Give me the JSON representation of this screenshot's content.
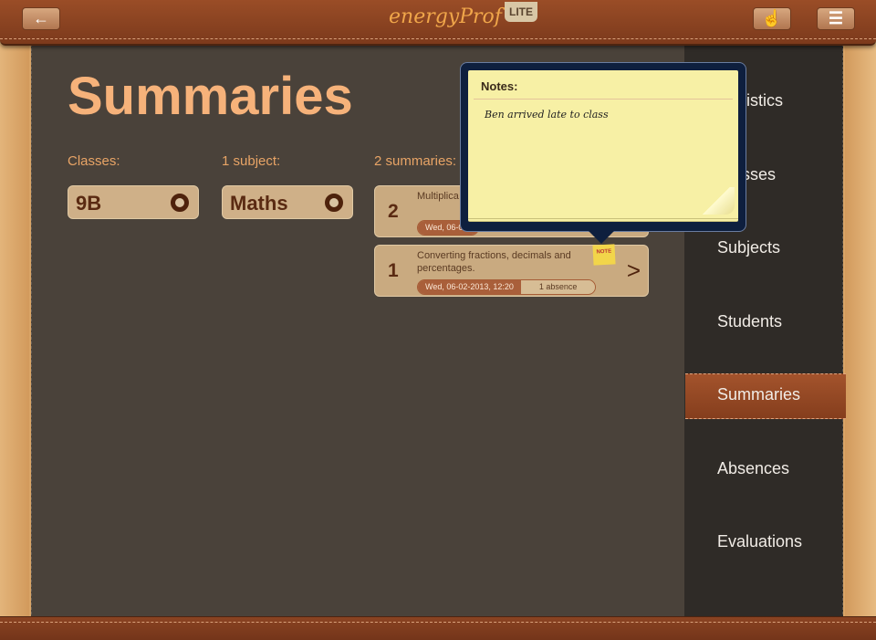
{
  "header": {
    "back_icon": "arrow-left-icon",
    "logo": "energyProf",
    "badge": "LITE",
    "touch_icon": "hand-pointer-icon",
    "menu_icon": "menu-icon"
  },
  "page": {
    "title": "Summaries"
  },
  "filters": {
    "classes_label": "Classes:",
    "class_value": "9B",
    "subjects_label": "1 subject:",
    "subject_value": "Maths",
    "summaries_label": "2 summaries:"
  },
  "summaries": [
    {
      "number": "2",
      "text": "Multiplica… numbers.",
      "date": "Wed, 06-0…"
    },
    {
      "number": "1",
      "text": "Converting fractions, decimals and percentages.",
      "date": "Wed, 06-02-2013, 12:20",
      "absences": "1 absence",
      "note_badge": "NOTE"
    }
  ],
  "popover": {
    "title": "Notes:",
    "body": "Ben arrived late to class"
  },
  "sidebar": {
    "items": [
      {
        "label": "Statistics"
      },
      {
        "label": "Classes"
      },
      {
        "label": "Subjects"
      },
      {
        "label": "Students"
      },
      {
        "label": "Summaries",
        "active": true
      },
      {
        "label": "Absences"
      },
      {
        "label": "Evaluations"
      }
    ]
  },
  "colors": {
    "accent": "#f6b27a",
    "leather": "#8b4322",
    "panel": "#4a423a",
    "note": "#f7f0a5"
  }
}
